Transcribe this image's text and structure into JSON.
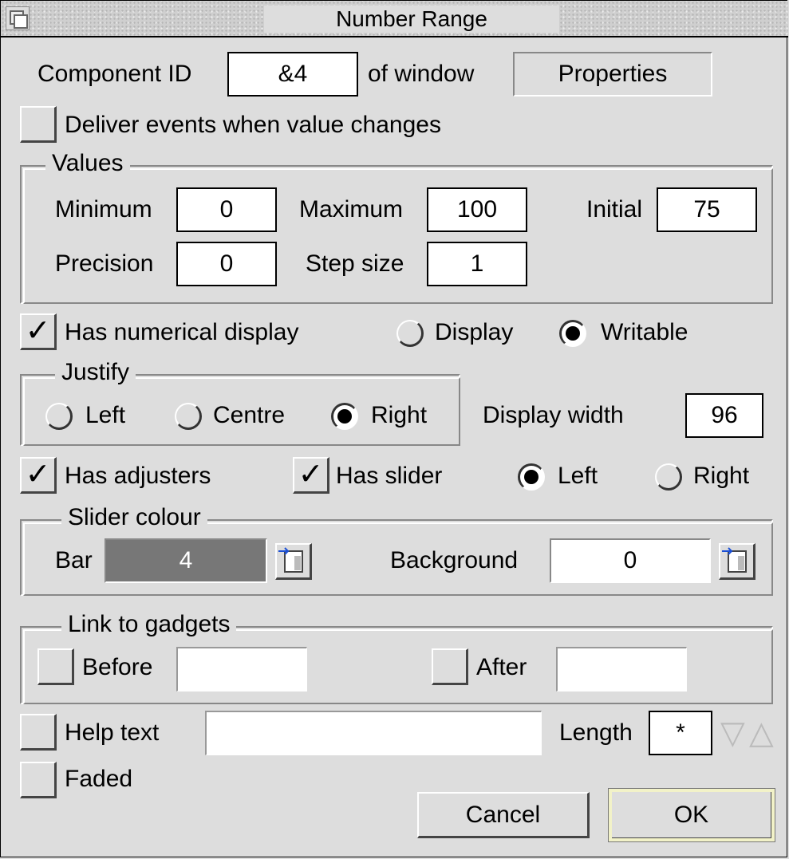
{
  "window": {
    "title": "Number Range"
  },
  "component": {
    "id_label": "Component ID",
    "id_value": "&4",
    "of_window_label": "of window",
    "window_value": "Properties"
  },
  "deliver_events": {
    "label": "Deliver events when value changes",
    "checked": false
  },
  "values": {
    "title": "Values",
    "minimum_label": "Minimum",
    "minimum": "0",
    "maximum_label": "Maximum",
    "maximum": "100",
    "initial_label": "Initial",
    "initial": "75",
    "precision_label": "Precision",
    "precision": "0",
    "step_label": "Step size",
    "step": "1"
  },
  "numerical_display": {
    "label": "Has numerical display",
    "checked": true,
    "display_label": "Display",
    "writable_label": "Writable",
    "selected": "Writable"
  },
  "justify": {
    "title": "Justify",
    "left_label": "Left",
    "centre_label": "Centre",
    "right_label": "Right",
    "selected": "Right"
  },
  "display_width": {
    "label": "Display width",
    "value": "96"
  },
  "adjusters": {
    "label": "Has adjusters",
    "checked": true
  },
  "slider": {
    "label": "Has slider",
    "checked": true,
    "left_label": "Left",
    "right_label": "Right",
    "selected": "Left"
  },
  "slider_colour": {
    "title": "Slider colour",
    "bar_label": "Bar",
    "bar_value": "4",
    "background_label": "Background",
    "background_value": "0",
    "bar_color": "#777777"
  },
  "link": {
    "title": "Link to gadgets",
    "before_label": "Before",
    "before_value": "",
    "after_label": "After",
    "after_value": ""
  },
  "help": {
    "label": "Help text",
    "value": "",
    "length_label": "Length",
    "length_value": "*"
  },
  "faded": {
    "label": "Faded"
  },
  "buttons": {
    "cancel": "Cancel",
    "ok": "OK"
  }
}
